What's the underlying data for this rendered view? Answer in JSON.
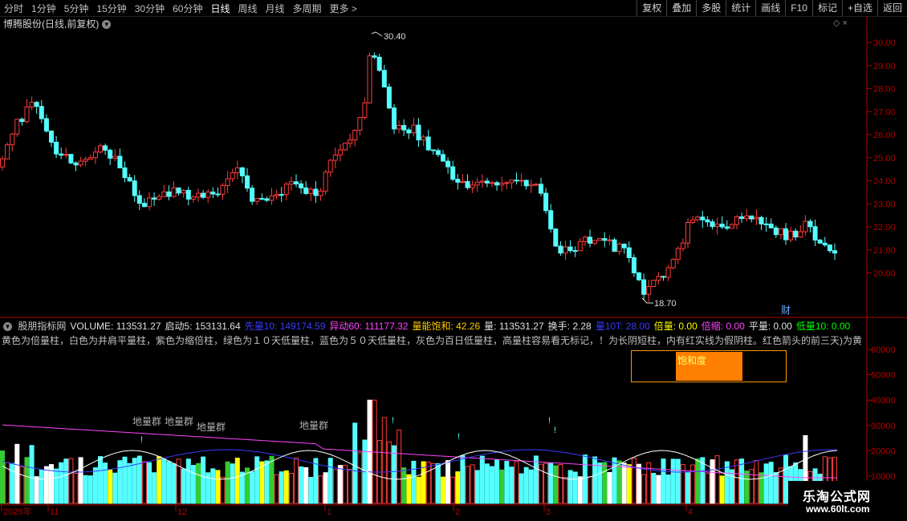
{
  "toolbar": {
    "periods": [
      {
        "label": "分时",
        "active": false
      },
      {
        "label": "1分钟",
        "active": false
      },
      {
        "label": "5分钟",
        "active": false
      },
      {
        "label": "15分钟",
        "active": false
      },
      {
        "label": "30分钟",
        "active": false
      },
      {
        "label": "60分钟",
        "active": false
      },
      {
        "label": "日线",
        "active": true
      },
      {
        "label": "周线",
        "active": false
      },
      {
        "label": "月线",
        "active": false
      },
      {
        "label": "多周期",
        "active": false
      },
      {
        "label": "更多 >",
        "active": false
      }
    ],
    "actions": [
      "复权",
      "叠加",
      "多股",
      "统计",
      "画线",
      "F10",
      "标记",
      "+自选",
      "返回"
    ]
  },
  "header": {
    "title": "博腾股份(日线,前复权)"
  },
  "price_panel": {
    "high_label": "30.40",
    "low_label": "18.70",
    "fin_marker": "财",
    "y_ticks": [
      "30.00",
      "29.00",
      "28.00",
      "27.00",
      "26.00",
      "25.00",
      "24.00",
      "23.00",
      "22.00",
      "21.00",
      "20.00"
    ]
  },
  "indicator_row": {
    "items": [
      {
        "text": "股朋指标网",
        "color": "#c8c8c8"
      },
      {
        "text": "VOLUME: 113531.27",
        "color": "#e0e0e0"
      },
      {
        "text": "启动5: 153131.64",
        "color": "#e0e0e0"
      },
      {
        "text": "先量10: 149174.59",
        "color": "#3a3aff"
      },
      {
        "text": "异动60: 111177.32",
        "color": "#ff44ff"
      },
      {
        "text": "量能饱和: 42.26",
        "color": "#ffcc00"
      },
      {
        "text": "量: 113531.27",
        "color": "#e0e0e0"
      },
      {
        "text": "换手: 2.28",
        "color": "#e0e0e0"
      },
      {
        "text": "量10T: 28.00",
        "color": "#3a3aff"
      },
      {
        "text": "倍量: 0.00",
        "color": "#ffff00"
      },
      {
        "text": "倍缩: 0.00",
        "color": "#ff44ff"
      },
      {
        "text": "平量: 0.00",
        "color": "#e0e0e0"
      },
      {
        "text": "低量10: 0.00",
        "color": "#00ff00"
      }
    ]
  },
  "description": "黄色为倍量柱，白色为并肩平量柱，紫色为缩倍柱，绿色为１０天低量柱，蓝色为５０天低量柱，灰色为百日低量柱，高量柱容易看无标记，！为长阴短柱，内有红实线为假阴柱。红色箭头的前三天)为黄",
  "saturation": {
    "label": "饱和度"
  },
  "volume_panel": {
    "y_ticks": [
      "60000",
      "50000",
      "40000",
      "30000",
      "20000",
      "10000"
    ],
    "ground_labels": [
      "地量群",
      "地量群",
      "地量群",
      "地量群"
    ],
    "bang": "!"
  },
  "x_axis": [
    "2025年",
    "11",
    "12",
    "1",
    "2",
    "3",
    "4"
  ],
  "watermark": {
    "line1": "乐淘公式网",
    "line2": "www.60lt.com"
  },
  "colors": {
    "up": "#ff3b3b",
    "down": "#54ffff",
    "axis": "#b00000",
    "text": "#c8c8c8"
  }
}
